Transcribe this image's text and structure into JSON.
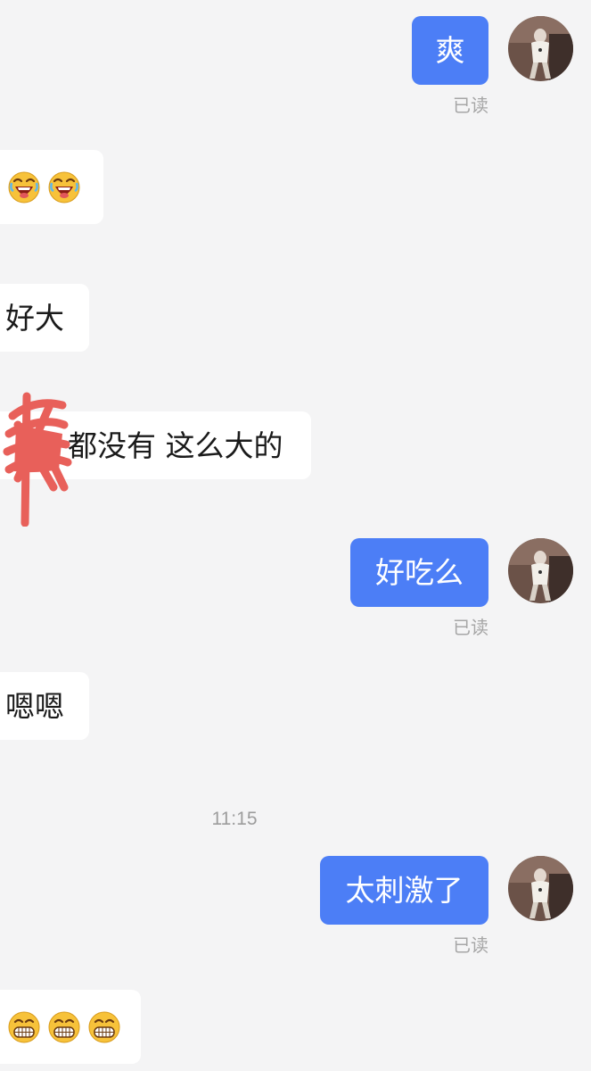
{
  "messages": [
    {
      "id": "m1",
      "direction": "out",
      "text": "爽",
      "read_status": "已读"
    },
    {
      "id": "m2",
      "direction": "in",
      "emojis": [
        "laughing-crying-emoji",
        "laughing-crying-emoji"
      ]
    },
    {
      "id": "m3",
      "direction": "in",
      "text": "好大"
    },
    {
      "id": "m4",
      "direction": "in",
      "text": "都没有 这么大的",
      "redacted_prefix": true
    },
    {
      "id": "m5",
      "direction": "out",
      "text": "好吃么",
      "read_status": "已读"
    },
    {
      "id": "m6",
      "direction": "in",
      "text": "嗯嗯"
    },
    {
      "id": "m7",
      "direction": "out",
      "text": "太刺激了",
      "read_status": "已读"
    },
    {
      "id": "m8",
      "direction": "in",
      "emojis": [
        "grinning-teeth-emoji",
        "grinning-teeth-emoji",
        "grinning-teeth-emoji"
      ]
    }
  ],
  "timestamp": "11:15",
  "colors": {
    "background": "#f4f4f5",
    "outgoing_bubble": "#4c7ef6",
    "incoming_bubble": "#ffffff",
    "read_receipt": "#a6a6a6",
    "redaction_scribble": "#e8605a"
  }
}
